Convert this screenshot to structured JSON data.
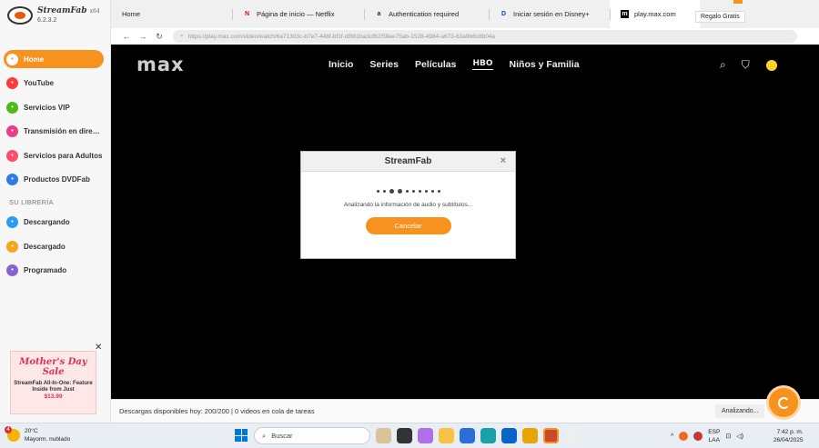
{
  "app": {
    "name": "StreamFab",
    "arch": "x64",
    "version": "6.2.3.2"
  },
  "sidebar": {
    "items": [
      {
        "label": "Home",
        "icon": "home-icon",
        "color": "#f7921e"
      },
      {
        "label": "YouTube",
        "icon": "youtube-icon",
        "color": "#ff3b3b"
      },
      {
        "label": "Servicios VIP",
        "icon": "key-icon",
        "color": "#4cbb17"
      },
      {
        "label": "Transmisión en dire…",
        "icon": "camera-icon",
        "color": "#e83e8c"
      },
      {
        "label": "Servicios para Adultos",
        "icon": "adult-icon",
        "color": "#ff4d6d"
      },
      {
        "label": "Productos DVDFab",
        "icon": "dvdfab-icon",
        "color": "#2f7de1"
      }
    ],
    "library_title": "SU LIBRERÍA",
    "library": [
      {
        "label": "Descargando",
        "icon": "download-icon",
        "color": "#2f9bf0"
      },
      {
        "label": "Descargado",
        "icon": "folder-icon",
        "color": "#f7a51e"
      },
      {
        "label": "Programado",
        "icon": "calendar-icon",
        "color": "#8a63d2"
      }
    ]
  },
  "promo": {
    "title": "Mother's Day Sale",
    "text": "StreamFab All-In-One: Feature Inside from Just",
    "price": "$13.99"
  },
  "tabs": [
    {
      "label": "Home",
      "favicon": ""
    },
    {
      "label": "Página de inicio — Netflix",
      "favicon": "N"
    },
    {
      "label": "Authentication required",
      "favicon": "a"
    },
    {
      "label": "Iniciar sesión en Disney+",
      "favicon": "D"
    },
    {
      "label": "play.max.com",
      "favicon": "m",
      "active": true
    }
  ],
  "gift_label": "Regalo Gratis",
  "address": {
    "url": "https://play.max.com/video/watch/6a71303c-b7e7-448f-bf1f-df881ba3cf62/59ee75ab-1528-4984-a673-63a9b6c8b04a"
  },
  "max": {
    "logo": "max",
    "nav": [
      "Inicio",
      "Series",
      "Películas",
      "HBO",
      "Niños y Familia"
    ]
  },
  "dialog": {
    "title": "StreamFab",
    "message": "Analizando la información de audio y subtítulos...",
    "button": "Cancelar"
  },
  "status": {
    "text": "Descargas disponibles hoy: 200/200 | 0 videos en cola de tareas",
    "analyzing": "Analizando..."
  },
  "taskbar": {
    "temp": "20°C",
    "weather": "Mayorm. nublado",
    "weather_badge": "4",
    "search": "Buscar",
    "lang": "ESP",
    "lang2": "LAA",
    "time": "7:42 p. m.",
    "date": "26/04/2025"
  }
}
